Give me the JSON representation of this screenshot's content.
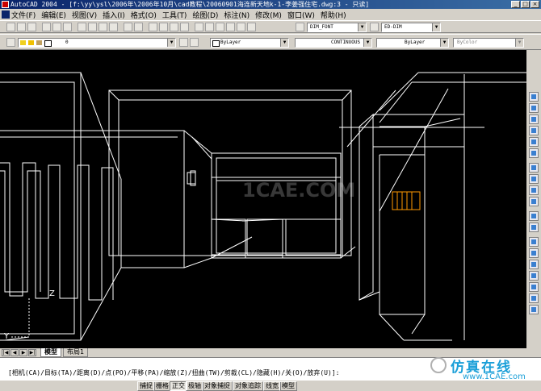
{
  "window": {
    "title": "AutoCAD 2004 - [f:\\yy\\ysl\\2006年\\2006年10月\\cad教程\\20060901海连新天地k-1-李姜强住宅.dwg:3 - 只读]",
    "controls": [
      "_",
      "□",
      "×"
    ]
  },
  "menu": {
    "items": [
      "文件(F)",
      "编辑(E)",
      "视图(V)",
      "插入(I)",
      "格式(O)",
      "工具(T)",
      "绘图(D)",
      "标注(N)",
      "修改(M)",
      "窗口(W)",
      "帮助(H)"
    ]
  },
  "toolbar_standard": {
    "text_style": "DIM_FONT",
    "dim_style": "ED-DIM"
  },
  "toolbar_layers": {
    "layer": "0",
    "color": "ByLayer",
    "linetype": "CONTINUOUS",
    "lineweight": "ByLayer",
    "plotstyle": "ByColor"
  },
  "viewport": {
    "watermark": "1CAE.COM",
    "ucs_z": "Z",
    "ucs_y": "Y"
  },
  "tabs": {
    "nav": [
      "|◀",
      "◀",
      "▶",
      "▶|"
    ],
    "model": "模型",
    "layout1": "布局1"
  },
  "command": {
    "line": "[相机(CA)/目标(TA)/距离(D)/点(PO)/平移(PA)/缩放(Z)/扭曲(TW)/剪裁(CL)/隐藏(H)/关(O)/放弃(U)]:"
  },
  "status": {
    "buttons": [
      "捕捉",
      "栅格",
      "正交",
      "极轴",
      "对象捕捉",
      "对象追踪",
      "线宽",
      "模型"
    ]
  },
  "branding": {
    "name": "仿真在线",
    "url": "www.1CAE.com"
  },
  "colors": {
    "title_start": "#0a246a",
    "viewport_bg": "#000000",
    "wire": "#ffffff",
    "highlight": "#ff9900",
    "brand": "#1a9fd8"
  }
}
